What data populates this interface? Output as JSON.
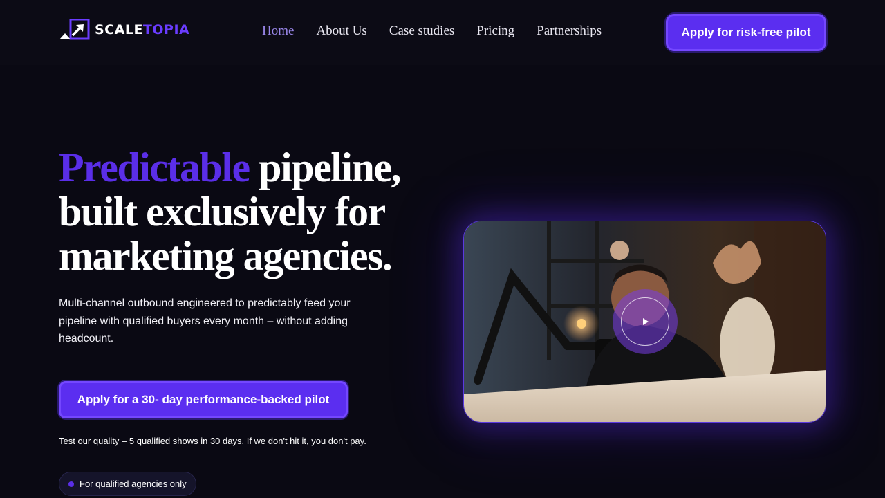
{
  "brand": {
    "logo_part1": "SCALE",
    "logo_part2": "TOPIA",
    "accent_color": "#5a2ee8"
  },
  "nav": {
    "items": [
      {
        "label": "Home",
        "active": true
      },
      {
        "label": "About Us",
        "active": false
      },
      {
        "label": "Case studies",
        "active": false
      },
      {
        "label": "Pricing",
        "active": false
      },
      {
        "label": "Partnerships",
        "active": false
      }
    ],
    "cta_label": "Apply for risk-free pilot"
  },
  "hero": {
    "title_accent": "Predictable",
    "title_rest": " pipeline, built exclusively for marketing agencies.",
    "subtitle": "Multi-channel outbound engineered to predictably feed your pipeline with qualified buyers every month – without adding headcount.",
    "cta_label": "Apply for a 30- day performance-backed pilot",
    "note": "Test our quality – 5 qualified shows in 30 days. If we don't hit it, you don't pay.",
    "badge": "For qualified agencies only"
  },
  "video": {
    "play_icon": "play-icon"
  }
}
